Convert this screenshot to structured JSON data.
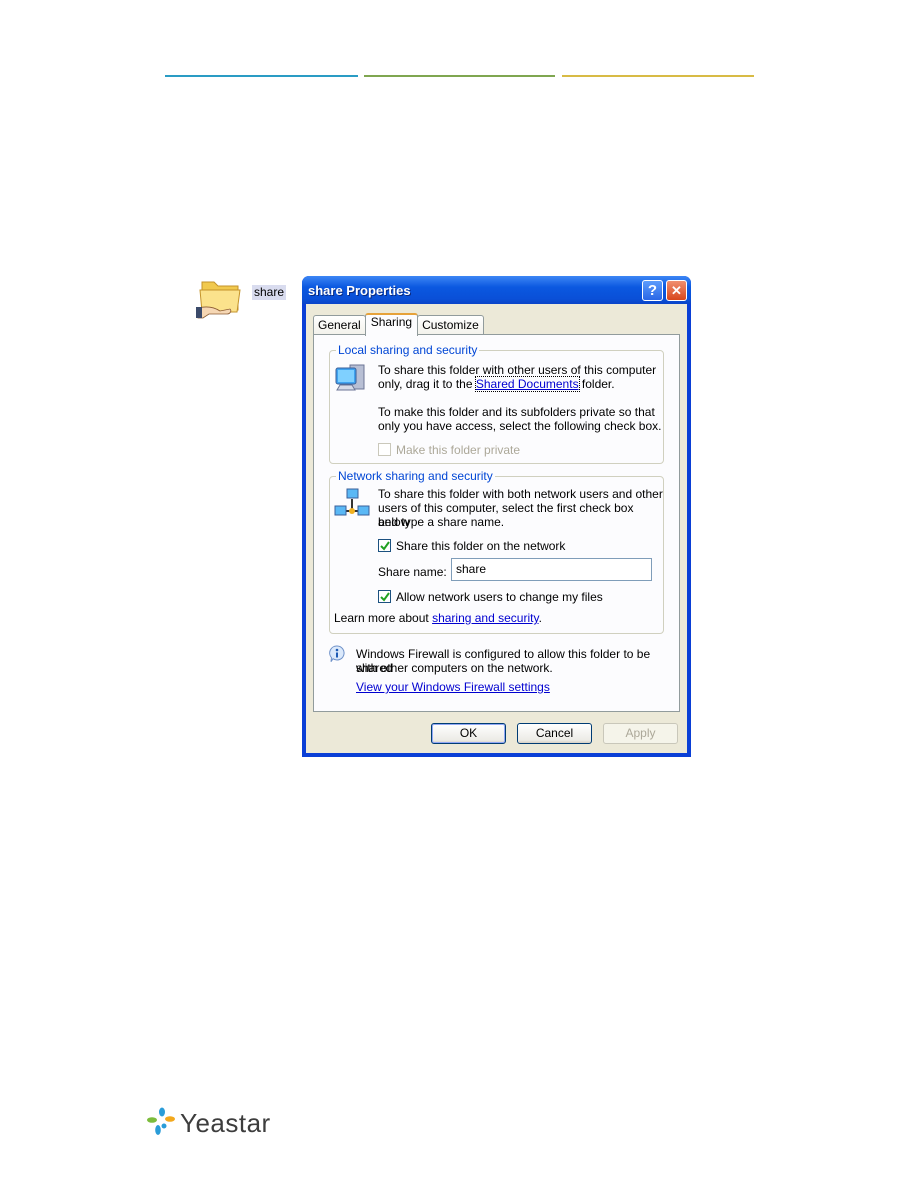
{
  "header": {
    "rule_colors": [
      "#2a9cc4",
      "#7fa650",
      "#d8bb45"
    ]
  },
  "desktop": {
    "folder_icon": "shared-folder-icon",
    "folder_label": "share"
  },
  "dialog": {
    "title": "share Properties",
    "help_label": "?",
    "close_label": "✕",
    "tabs": [
      {
        "label": "General",
        "active": false
      },
      {
        "label": "Sharing",
        "active": true
      },
      {
        "label": "Customize",
        "active": false
      }
    ],
    "local": {
      "title": "Local sharing and security",
      "icon": "computer-icon",
      "line1": "To share this folder with other users of this computer",
      "line2_prefix": "only, drag it to the ",
      "line2_link": "Shared Documents",
      "line2_suffix": " folder.",
      "line3": "To make this folder and its subfolders private so that",
      "line4": "only you have access, select the following check box.",
      "private_checkbox": {
        "label": "Make this folder private",
        "checked": false,
        "enabled": false
      }
    },
    "network": {
      "title": "Network sharing and security",
      "icon": "network-icon",
      "line1": "To share this folder with both network users and other",
      "line2": "users of this computer, select the first check box below",
      "line3": "and type a share name.",
      "share_checkbox": {
        "label": "Share this folder on the network",
        "checked": true
      },
      "share_name_label": "Share name:",
      "share_name_value": "share",
      "allow_checkbox": {
        "label": "Allow network users to change my files",
        "checked": true
      },
      "learn_prefix": "Learn more about ",
      "learn_link": "sharing and security",
      "learn_suffix": "."
    },
    "firewall": {
      "icon": "info-icon",
      "line1": "Windows Firewall is configured to allow this folder to be shared",
      "line2": "with other computers on the network.",
      "link": "View your Windows Firewall settings"
    },
    "buttons": {
      "ok": "OK",
      "cancel": "Cancel",
      "apply": "Apply"
    }
  },
  "footer": {
    "logo_text": "Yeastar"
  }
}
